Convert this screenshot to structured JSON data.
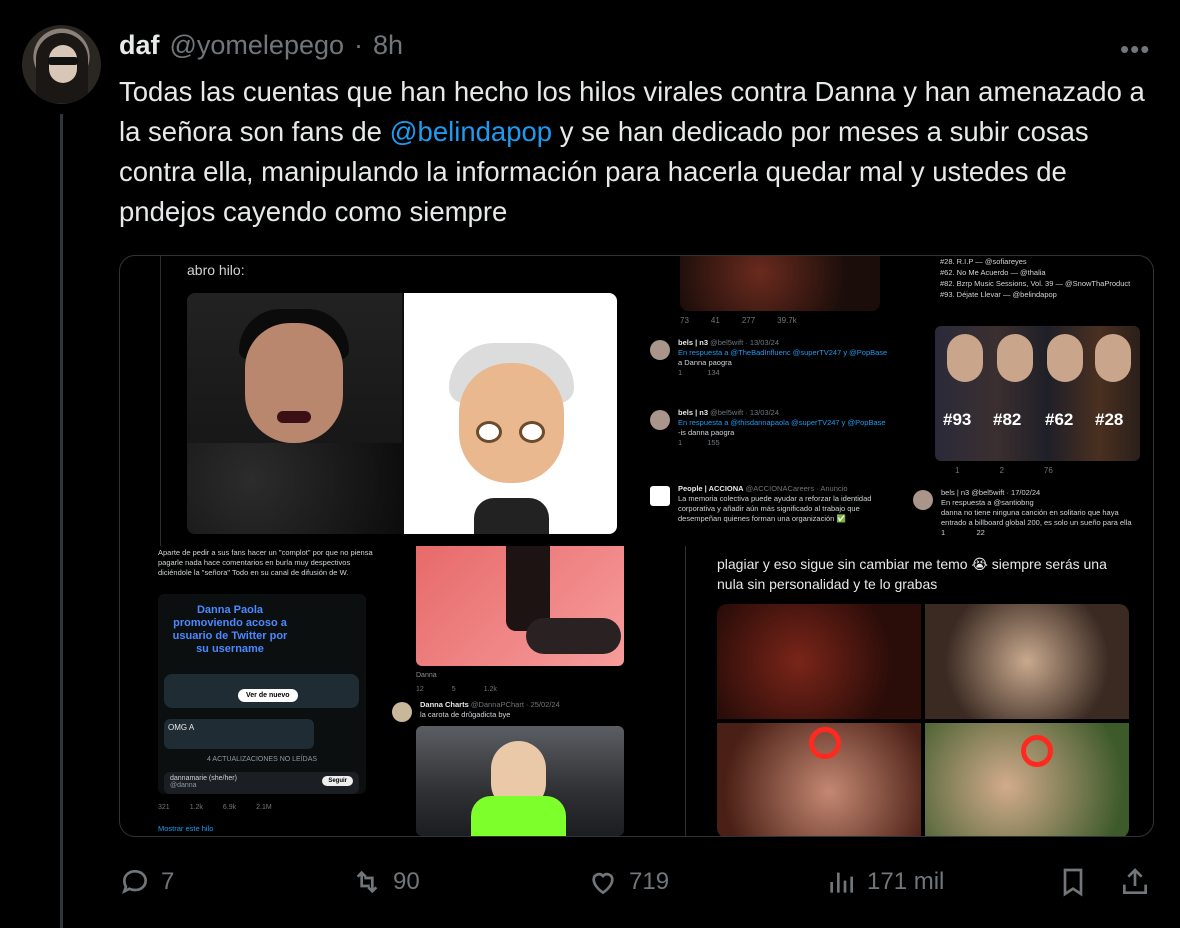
{
  "tweet": {
    "name": "daf",
    "handle": "@yomelepego",
    "dot": "·",
    "time": "8h",
    "text_before": "Todas las cuentas que han hecho los hilos virales contra Danna y han amenazado a la señora son fans de ",
    "mention": "@belindapop",
    "text_after": " y se han dedicado por meses a subir cosas contra ella, manipulando la información para hacerla quedar mal y ustedes de pndejos cayendo como siempre",
    "more_icon": "more-dots-icon"
  },
  "media": {
    "abro_hilo": "abro hilo:",
    "top_actions": [
      "73",
      "41",
      "277",
      "39.7k"
    ],
    "mini_tweets": [
      {
        "user": "bels | n3",
        "meta": "@bel5wift · 13/03/24",
        "reply": "En respuesta a @TheBadInfluenc @superTV247 y @PopBase",
        "body": "a Danna paogra",
        "stats": [
          "1",
          "134"
        ]
      },
      {
        "user": "bels | n3",
        "meta": "@bel5wift · 13/03/24",
        "reply": "En respuesta a @thisdannapaola @superTV247 y @PopBase",
        "body": "-is danna paogra",
        "stats": [
          "1",
          "155"
        ]
      },
      {
        "user": "People | ACCIONA",
        "meta": "@ACCIONACareers · Anuncio",
        "reply": "",
        "body": "La memoria colectiva puede ayudar a reforzar la identidad corporativa y añadir aún más significado al trabajo que desempeñan quienes forman una organización ✅",
        "stats": []
      }
    ],
    "chart_list": [
      "#28. R.I.P — @sofiareyes",
      "#62. No Me Acuerdo — @thalia",
      "#82. Bzrp Music Sessions, Vol. 39 — @SnowThaProduct",
      "#93. Déjate Llevar — @belindapop"
    ],
    "ranks": [
      "#93",
      "#82",
      "#62",
      "#28"
    ],
    "chart_stats": [
      "1",
      "2",
      "76"
    ],
    "right_reply": {
      "user": "bels | n3",
      "meta": "@bel5wift · 17/02/24",
      "reply": "En respuesta a @santiobng",
      "body": "danna no tiene ninguna canción en solitario que haya entrado a billboard global 200, es solo un sueño para ella",
      "stats": [
        "1",
        "22"
      ]
    },
    "left_note": "Aparte de pedir a sus fans hacer un \"complot\" por que no piensa pagarle nada hace comentarios en burla muy despectivos diciéndole la \"señora\" Todo en su canal de difusión de W.",
    "chat_big": "Danna Paola promoviendo acoso a usuario de Twitter por su username",
    "ver_de_nuevo": "Ver de nuevo",
    "omg": "OMG A",
    "updates": "4 ACTUALIZACIONES NO LEÍDAS",
    "card_user": "dannamarie (she/her)",
    "card_handle": "@danna",
    "follow": "Seguir",
    "left_stats": [
      "321",
      "1.2k",
      "6.9k",
      "2.1M"
    ],
    "mostrar": "Mostrar este hilo",
    "danna_caption": "Danna",
    "mid_stats": [
      "12",
      "5",
      "1.2k"
    ],
    "dc_user": "Danna Charts",
    "dc_meta": "@DannaPChart · 25/02/24",
    "dc_body": "la carota de drŭgadicta bye",
    "right_text": "plagiar y eso sigue sin cambiar me temo 😭 siempre serás una nula sin personalidad y te lo grabas"
  },
  "actions": {
    "replies": "7",
    "retweets": "90",
    "likes": "719",
    "views": "171 mil"
  }
}
